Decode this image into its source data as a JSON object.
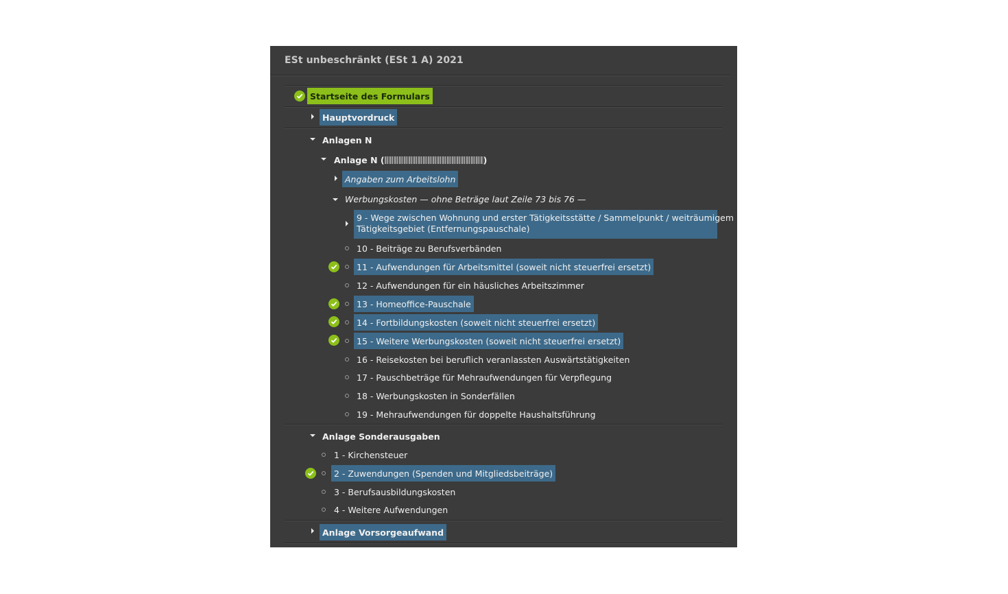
{
  "window": {
    "title": "ESt unbeschränkt (ESt 1 A)  2021"
  },
  "tree": {
    "start": {
      "label": "Startseite des Formulars",
      "checked": true
    },
    "hauptvordruck": {
      "label": "Hauptvordruck"
    },
    "anlagen_n": {
      "label": "Anlagen N",
      "anlage_n": {
        "label_prefix": "Anlage N (",
        "label_suffix": ")",
        "arbeitslohn": {
          "label": "Angaben zum Arbeitslohn"
        },
        "werbungskosten": {
          "label": "Werbungskosten — ohne Beträge laut Zeile 73 bis 76 —",
          "items": [
            {
              "label": "9 - Wege zwischen Wohnung und erster Tätigkeitsstätte / Sammelpunkt / weiträumigem",
              "label2": "Tätigkeitsgebiet (Entfernungspauschale)",
              "highlighted": true,
              "checked": false
            },
            {
              "label": "10 - Beiträge zu Berufsverbänden",
              "highlighted": false,
              "checked": false
            },
            {
              "label": "11 - Aufwendungen für Arbeitsmittel (soweit nicht steuerfrei ersetzt)",
              "highlighted": true,
              "checked": true
            },
            {
              "label": "12 - Aufwendungen für ein häusliches Arbeitszimmer",
              "highlighted": false,
              "checked": false
            },
            {
              "label": "13 - Homeoffice-Pauschale",
              "highlighted": true,
              "checked": true
            },
            {
              "label": "14 - Fortbildungskosten (soweit nicht steuerfrei ersetzt)",
              "highlighted": true,
              "checked": true
            },
            {
              "label": "15 - Weitere Werbungskosten (soweit nicht steuerfrei ersetzt)",
              "highlighted": true,
              "checked": true
            },
            {
              "label": "16 - Reisekosten bei beruflich veranlassten Auswärtstätigkeiten",
              "highlighted": false,
              "checked": false
            },
            {
              "label": "17 - Pauschbeträge für Mehraufwendungen für Verpflegung",
              "highlighted": false,
              "checked": false
            },
            {
              "label": "18 - Werbungskosten in Sonderfällen",
              "highlighted": false,
              "checked": false
            },
            {
              "label": "19 - Mehraufwendungen für doppelte Haushaltsführung",
              "highlighted": false,
              "checked": false
            }
          ]
        }
      }
    },
    "sonderausgaben": {
      "label": "Anlage Sonderausgaben",
      "items": [
        {
          "label": "1 - Kirchensteuer",
          "highlighted": false,
          "checked": false
        },
        {
          "label": "2 - Zuwendungen (Spenden und Mitgliedsbeiträge)",
          "highlighted": true,
          "checked": true
        },
        {
          "label": "3 - Berufsausbildungskosten",
          "highlighted": false,
          "checked": false
        },
        {
          "label": "4 - Weitere Aufwendungen",
          "highlighted": false,
          "checked": false
        }
      ]
    },
    "vorsorgeaufwand": {
      "label": "Anlage Vorsorgeaufwand"
    }
  },
  "icons": {
    "check": "check-circle-icon",
    "expand": "triangle-right-icon",
    "collapse": "triangle-down-icon",
    "bullet": "bullet-icon"
  },
  "colors": {
    "panel_bg": "#3b3b3b",
    "highlight_blue": "#3d6a8a",
    "highlight_green": "#8cbf1a",
    "check_green": "#8cbf1a"
  }
}
